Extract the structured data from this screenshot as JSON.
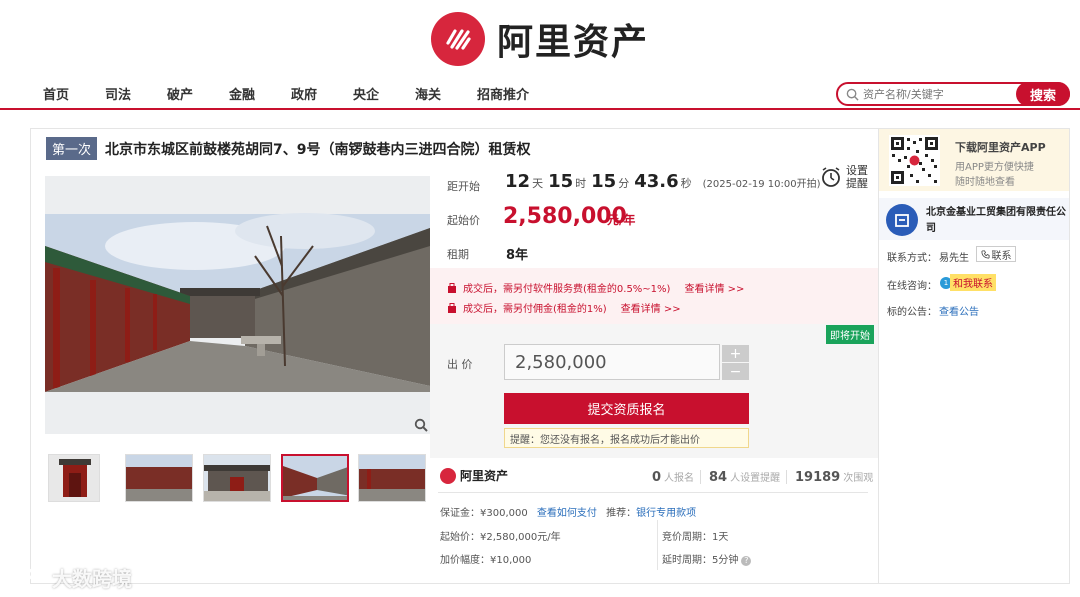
{
  "header": {
    "logo_text": "阿里资产",
    "nav": [
      "首页",
      "司法",
      "破产",
      "金融",
      "政府",
      "央企",
      "海关",
      "招商推介"
    ],
    "search": {
      "placeholder": "资产名称/关键字",
      "button": "搜索"
    }
  },
  "listing": {
    "round_badge": "第一次",
    "title": "北京市东城区前鼓楼苑胡同7、9号（南锣鼓巷内三进四合院）租赁权",
    "countdown": {
      "label": "距开始",
      "days": "12",
      "days_unit": "天",
      "hours": "15",
      "hours_unit": "时",
      "minutes": "15",
      "minutes_unit": "分",
      "seconds": "43.6",
      "seconds_unit": "秒",
      "start_time": "(2025-02-19 10:00开拍)"
    },
    "reminder": "设置提醒",
    "start_price_label": "起始价",
    "start_price": "2,580,000",
    "start_price_unit": "元/年",
    "term_label": "租期",
    "term": "8年",
    "notices": [
      {
        "text": "成交后，需另付软件服务费(租金的0.5%~1%)",
        "link": "查看详情 >>"
      },
      {
        "text": "成交后，需另付佣金(租金的1%)",
        "link": "查看详情 >>"
      }
    ],
    "soon_badge": "即将开始",
    "bid_label": "出 价",
    "bid_value": "2,580,000",
    "plus": "+",
    "minus": "−",
    "submit": "提交资质报名",
    "tip": "提醒：您还没有报名，报名成功后才能出价"
  },
  "stats": {
    "logo_text": "阿里资产",
    "signups": "0",
    "signups_label": "人报名",
    "reminders": "84",
    "reminders_label": "人设置提醒",
    "views": "19189",
    "views_label": "次围观"
  },
  "details": {
    "deposit_label": "保证金：",
    "deposit": "¥300,000",
    "deposit_link": "查看如何支付",
    "recommend_label": "推荐：",
    "recommend_link": "银行专用款项",
    "start_price": "起始价：¥2,580,000元/年",
    "increment": "加价幅度：¥10,000",
    "cycle": "竞价周期：1天",
    "delay": "延时周期：5分钟"
  },
  "sidebar": {
    "app_title": "下载阿里资产APP",
    "app_sub1": "用APP更方便快捷",
    "app_sub2": "随时随地查看",
    "org_name": "北京金基业工贸集团有限责任公司",
    "contact_label": "联系方式：",
    "contact_name": "易先生",
    "contact_btn": "联系",
    "chat_label": "在线咨询：",
    "chat_btn": "和我联系",
    "notice_label": "标的公告：",
    "notice_link": "查看公告"
  },
  "watermark": "大数跨境",
  "colors": {
    "brand_red": "#c8102e",
    "badge_blue": "#5a6a8a",
    "soon_green": "#1aa35b"
  }
}
